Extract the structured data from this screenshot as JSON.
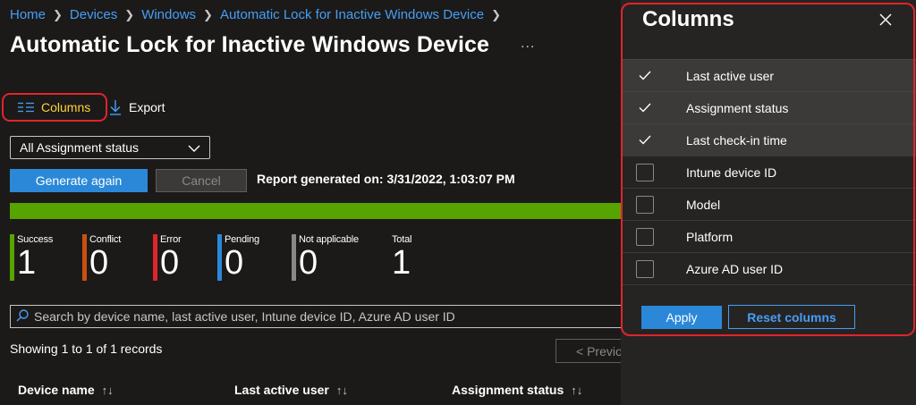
{
  "breadcrumb": [
    "Home",
    "Devices",
    "Windows",
    "Automatic Lock for Inactive Windows Device"
  ],
  "page_title": "Automatic Lock for Inactive Windows Device",
  "more_menu": "...",
  "toolbar": {
    "columns_label": "Columns",
    "export_label": "Export"
  },
  "filter": {
    "selected": "All Assignment status"
  },
  "actions": {
    "generate_label": "Generate again",
    "cancel_label": "Cancel",
    "report_generated": "Report generated on: 3/31/2022, 1:03:07 PM"
  },
  "progress": {
    "fraction": 1.0,
    "color": "#57a300"
  },
  "stats": [
    {
      "label": "Success",
      "value": "1",
      "color": "#57a300"
    },
    {
      "label": "Conflict",
      "value": "0",
      "color": "#ca5010"
    },
    {
      "label": "Error",
      "value": "0",
      "color": "#e0242b"
    },
    {
      "label": "Pending",
      "value": "0",
      "color": "#2b88d8"
    },
    {
      "label": "Not applicable",
      "value": "0",
      "color": "#8a8886"
    },
    {
      "label": "Total",
      "value": "1",
      "color": ""
    }
  ],
  "search": {
    "placeholder": "Search by device name, last active user, Intune device ID, Azure AD user ID"
  },
  "records": "Showing 1 to 1 of 1 records",
  "pagination": {
    "prev_label": "< Previous"
  },
  "table": {
    "headers": [
      "Device name",
      "Last active user",
      "Assignment status"
    ]
  },
  "panel": {
    "title": "Columns",
    "options": [
      {
        "label": "Last active user",
        "checked": true
      },
      {
        "label": "Assignment status",
        "checked": true
      },
      {
        "label": "Last check-in time",
        "checked": true
      },
      {
        "label": "Intune device ID",
        "checked": false
      },
      {
        "label": "Model",
        "checked": false
      },
      {
        "label": "Platform",
        "checked": false
      },
      {
        "label": "Azure AD user ID",
        "checked": false
      }
    ],
    "apply_label": "Apply",
    "reset_label": "Reset columns"
  },
  "colors": {
    "accent": "#2b88d8",
    "link": "#479ef5",
    "highlight": "#e0242b",
    "background": "#1b1a19",
    "panel": "#252423"
  }
}
